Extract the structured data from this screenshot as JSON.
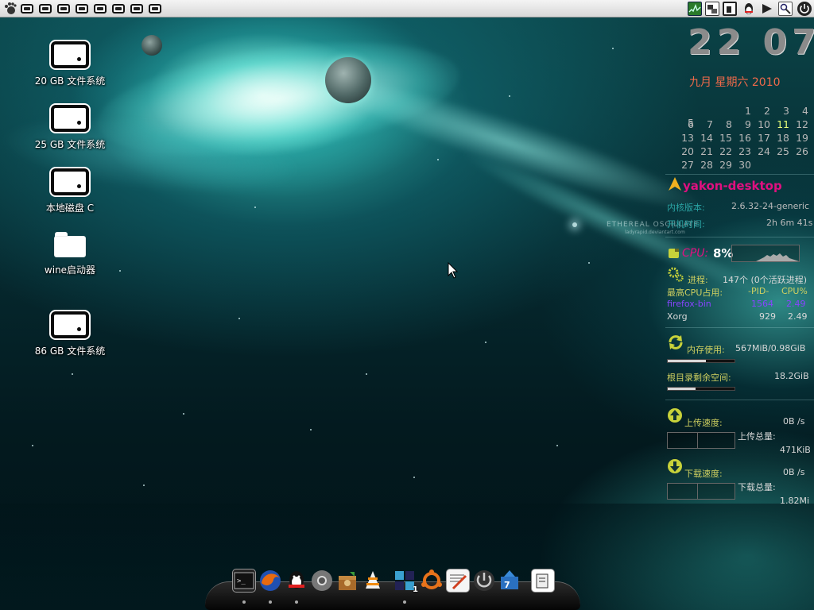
{
  "colors": {
    "accent_teal": "#3fd6c8",
    "hostname": "#e01080",
    "cpu_label": "#e01080",
    "firefox_row": "#8844ff",
    "label_yellow": "#cfd060"
  },
  "topbar": {
    "menu_icon": "gnome-foot-icon",
    "window_buttons": [
      "window-1",
      "window-2",
      "window-3",
      "window-4",
      "window-5",
      "window-6",
      "window-7",
      "window-8"
    ],
    "tray_icons": [
      "system-monitor-icon",
      "network-icon",
      "display-icon",
      "qq-icon",
      "volume-icon",
      "search-icon",
      "power-icon"
    ]
  },
  "desktop_icons": [
    {
      "label": "20 GB 文件系统",
      "icon": "drive-icon"
    },
    {
      "label": "25 GB 文件系统",
      "icon": "drive-icon"
    },
    {
      "label": "本地磁盘 C",
      "icon": "drive-icon"
    },
    {
      "label": "wine启动器",
      "icon": "folder-icon"
    },
    {
      "label": "86 GB 文件系统",
      "icon": "drive-icon"
    }
  ],
  "wallpaper": {
    "watermark_title": "ETHEREAL OSCILLATE",
    "watermark_sub": "ladyrapid.deviantart.com"
  },
  "conky": {
    "time": "22 07",
    "date": "九月 星期六 2010",
    "calendar": [
      [
        "",
        "",
        "",
        "1",
        "2",
        "3",
        "4",
        "5"
      ],
      [
        "6",
        "7",
        "8",
        "9",
        "10",
        "11",
        "12"
      ],
      [
        "13",
        "14",
        "15",
        "16",
        "17",
        "18",
        "19"
      ],
      [
        "20",
        "21",
        "22",
        "23",
        "24",
        "25",
        "26"
      ],
      [
        "27",
        "28",
        "29",
        "30",
        "",
        "",
        ""
      ]
    ],
    "today": "11",
    "hostname": "yakon-desktop",
    "kernel_label": "内核版本:",
    "kernel_value": "2.6.32-24-generic",
    "uptime_label": "开机时间:",
    "uptime_value": "2h 6m 41s",
    "cpu_label": "CPU:",
    "cpu_value": "8%",
    "proc_label": "进程:",
    "proc_value": "147个 (0个活跃进程)",
    "top_label": "最高CPU占用:",
    "top_pid_header": "-PID-",
    "top_cpu_header": "CPU%",
    "top_rows": [
      {
        "name": "firefox-bin",
        "pid": "1564",
        "cpu": "2.49"
      },
      {
        "name": "Xorg",
        "pid": "929",
        "cpu": "2.49"
      }
    ],
    "mem_label": "内存使用:",
    "mem_value": "567MiB/0.98GiB",
    "mem_fraction": 0.57,
    "disk_label": "根目录剩余空间:",
    "disk_value": "18.2GiB",
    "disk_fraction": 0.42,
    "up_speed_label": "上传速度:",
    "up_speed_value": "0B /s",
    "up_total_label": "上传总量:",
    "up_total_value": "471KiB",
    "down_speed_label": "下载速度:",
    "down_speed_value": "0B /s",
    "down_total_label": "下载总量:",
    "down_total_value": "1.82Mi"
  },
  "dock": {
    "icons": [
      "terminal-icon",
      "firefox-icon",
      "qq-icon",
      "chrome-icon",
      "package-icon",
      "vlc-icon",
      "window-switcher-icon",
      "ubuntu-icon",
      "text-editor-icon",
      "power-icon",
      "update-icon",
      "document-icon"
    ],
    "badges": {
      "window-switcher-icon": "1",
      "update-icon": "7"
    }
  }
}
